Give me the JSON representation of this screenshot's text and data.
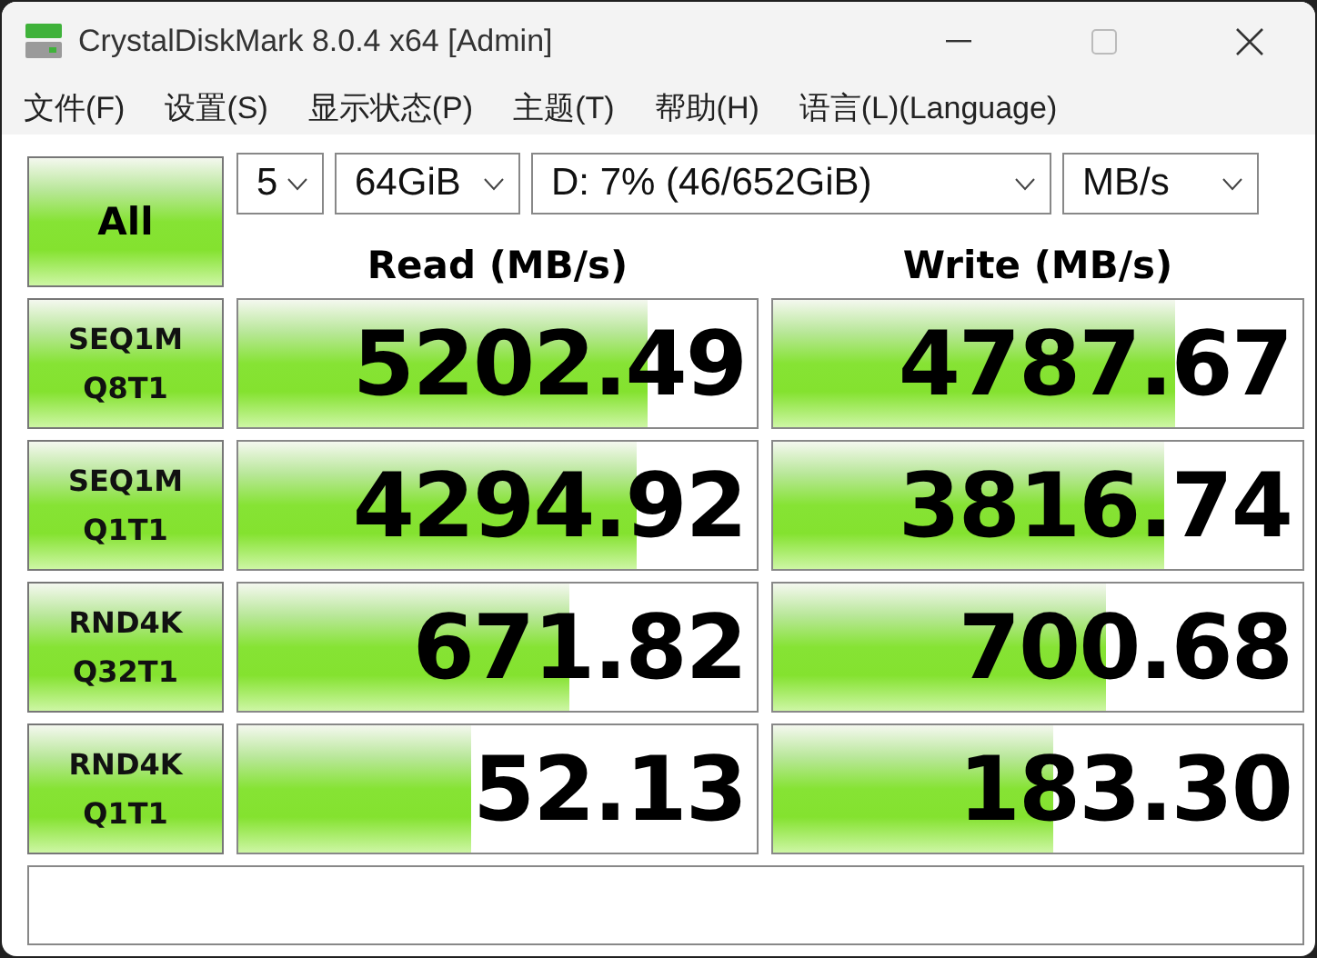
{
  "window": {
    "title": "CrystalDiskMark 8.0.4 x64 [Admin]"
  },
  "menu": [
    "文件(F)",
    "设置(S)",
    "显示状态(P)",
    "主题(T)",
    "帮助(H)",
    "语言(L)(Language)"
  ],
  "all_button": "All",
  "selects": [
    {
      "value": "5"
    },
    {
      "value": "64GiB"
    },
    {
      "value": "D: 7% (46/652GiB)"
    },
    {
      "value": "MB/s"
    }
  ],
  "columns": [
    "Read (MB/s)",
    "Write (MB/s)"
  ],
  "rows": [
    {
      "line1": "SEQ1M",
      "line2": "Q8T1",
      "read": {
        "value": "5202.49",
        "level": 0.79
      },
      "write": {
        "value": "4787.67",
        "level": 0.76
      }
    },
    {
      "line1": "SEQ1M",
      "line2": "Q1T1",
      "read": {
        "value": "4294.92",
        "level": 0.77
      },
      "write": {
        "value": "3816.74",
        "level": 0.74
      }
    },
    {
      "line1": "RND4K",
      "line2": "Q32T1",
      "read": {
        "value": "671.82",
        "level": 0.64
      },
      "write": {
        "value": "700.68",
        "level": 0.63
      }
    },
    {
      "line1": "RND4K",
      "line2": "Q1T1",
      "read": {
        "value": "52.13",
        "level": 0.45
      },
      "write": {
        "value": "183.30",
        "level": 0.53
      }
    }
  ]
}
